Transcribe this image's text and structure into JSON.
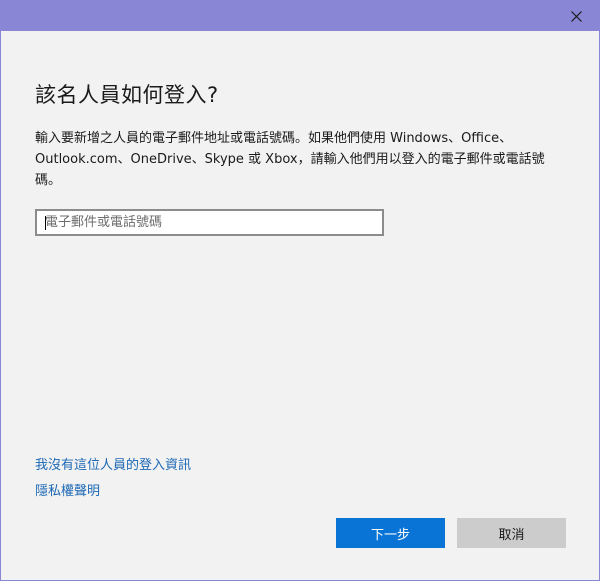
{
  "window": {
    "titlebar_color": "#8a86d6",
    "close_icon": "close-icon"
  },
  "heading": "該名人員如何登入?",
  "description": "輸入要新增之人員的電子郵件地址或電話號碼。如果他們使用 Windows、Office、Outlook.com、OneDrive、Skype 或 Xbox，請輸入他們用以登入的電子郵件或電話號碼。",
  "account_field": {
    "value": "",
    "placeholder": "電子郵件或電話號碼"
  },
  "links": {
    "no_signin_info": "我沒有這位人員的登入資訊",
    "privacy": "隱私權聲明"
  },
  "buttons": {
    "next": "下一步",
    "cancel": "取消"
  },
  "colors": {
    "accent": "#0a74d6",
    "link": "#1d68b5"
  }
}
